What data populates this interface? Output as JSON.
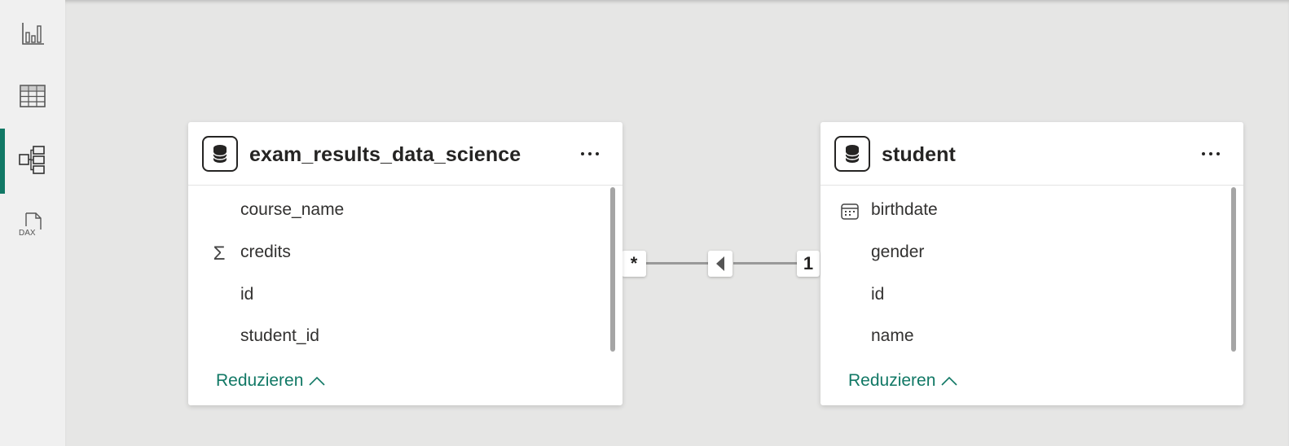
{
  "rail": {
    "items": [
      {
        "name": "report-view",
        "icon": "bar-chart-icon",
        "active": false
      },
      {
        "name": "data-view",
        "icon": "table-grid-icon",
        "active": false
      },
      {
        "name": "model-view",
        "icon": "model-diagram-icon",
        "active": true
      },
      {
        "name": "dax-query-view",
        "icon": "dax-icon",
        "active": false,
        "icon_text": "DAX"
      }
    ],
    "accent": "#117865"
  },
  "tables": [
    {
      "title": "exam_results_data_science",
      "fields": [
        {
          "label": "course_name",
          "icon": ""
        },
        {
          "label": "credits",
          "icon": "sigma-icon"
        },
        {
          "label": "id",
          "icon": ""
        },
        {
          "label": "student_id",
          "icon": ""
        }
      ],
      "collapse_label": "Reduzieren"
    },
    {
      "title": "student",
      "fields": [
        {
          "label": "birthdate",
          "icon": "calendar-icon"
        },
        {
          "label": "gender",
          "icon": ""
        },
        {
          "label": "id",
          "icon": ""
        },
        {
          "label": "name",
          "icon": ""
        }
      ],
      "collapse_label": "Reduzieren"
    }
  ],
  "relationship": {
    "from_cardinality": "*",
    "to_cardinality": "1",
    "direction": "single"
  },
  "symbols": {
    "sigma": "Σ"
  },
  "colors": {
    "canvas": "#e6e6e5",
    "link": "#117865",
    "line": "#999999"
  }
}
